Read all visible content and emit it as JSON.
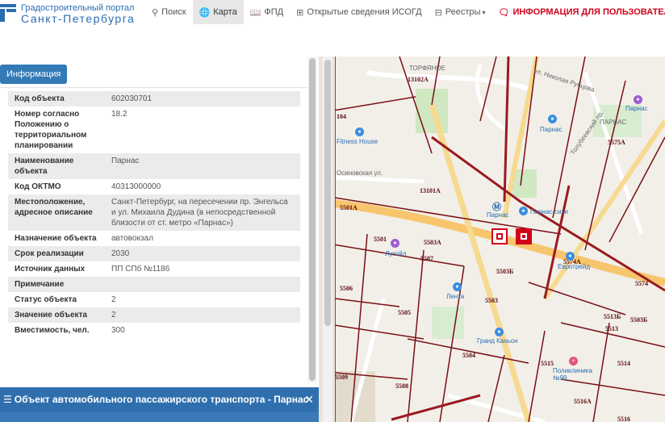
{
  "header": {
    "portal_line1": "Градостроительный портал",
    "portal_line2": "Санкт-Петербурга",
    "nav": [
      {
        "label": "Поиск",
        "icon": "search-icon",
        "active": false
      },
      {
        "label": "Карта",
        "icon": "globe-icon",
        "active": true
      },
      {
        "label": "ФПД",
        "icon": "book-icon",
        "active": false
      },
      {
        "label": "Открытые сведения ИСОГД",
        "icon": "plus-square-icon",
        "active": false
      },
      {
        "label": "Реестры",
        "icon": "table-icon",
        "active": false
      },
      {
        "label": "ИНФОРМАЦИЯ ДЛЯ ПОЛЬЗОВАТЕЛ",
        "icon": "comment-icon",
        "active": false
      }
    ]
  },
  "panel": {
    "info_button": "Информация",
    "rows": [
      {
        "key": "Код объекта",
        "value": "602030701"
      },
      {
        "key": "Номер согласно Положению о территориальном планировании",
        "value": "18.2"
      },
      {
        "key": "Наименование объекта",
        "value": "Парнас"
      },
      {
        "key": "Код ОКТМО",
        "value": "40313000000"
      },
      {
        "key": "Местоположение, адресное описание",
        "value": "Санкт-Петербург, на пересечении пр. Энгельса и ул. Михаила Дудина (в непосредственной близости от ст. метро «Парнас»)"
      },
      {
        "key": "Назначение объекта",
        "value": "автовокзал"
      },
      {
        "key": "Срок реализации",
        "value": "2030"
      },
      {
        "key": "Источник данных",
        "value": "ПП СПб №1186"
      },
      {
        "key": "Примечание",
        "value": ""
      },
      {
        "key": "Статус объекта",
        "value": "2"
      },
      {
        "key": "Значение объекта",
        "value": "2"
      },
      {
        "key": "Вместимость, чел.",
        "value": "300"
      }
    ]
  },
  "bottom_bar": {
    "title": "Объект автомобильного пассажирского транспорта - Парнас"
  },
  "map": {
    "parcels": [
      "13102А",
      "13101А",
      "5501А",
      "5501",
      "5503А",
      "5507",
      "5503Б",
      "5506",
      "5503",
      "5505",
      "5504",
      "5509",
      "5508",
      "5515",
      "5514",
      "5516А",
      "5516",
      "5574",
      "5574А",
      "5575А",
      "5513Б",
      "5503Б",
      "5513",
      "104"
    ],
    "pois": [
      "Fitness House",
      "Парнас",
      "Парнас-сити",
      "Лукойл",
      "Лента",
      "Гранд Каньон",
      "Поликлиника №99",
      "Евротрейд",
      "ПАРНАС",
      "ТОРФЯНОЕ"
    ],
    "streets": [
      "ул. Николая Рубцова",
      "Толубеевский пр.",
      "Осиновская ул."
    ],
    "metro_label": "Парнас",
    "colors": {
      "parcel_border": "#7a0f14",
      "road_main": "#f7c56b",
      "road_minor": "#ffffff",
      "marker": "#d0021b",
      "accent": "#337ab7"
    }
  }
}
